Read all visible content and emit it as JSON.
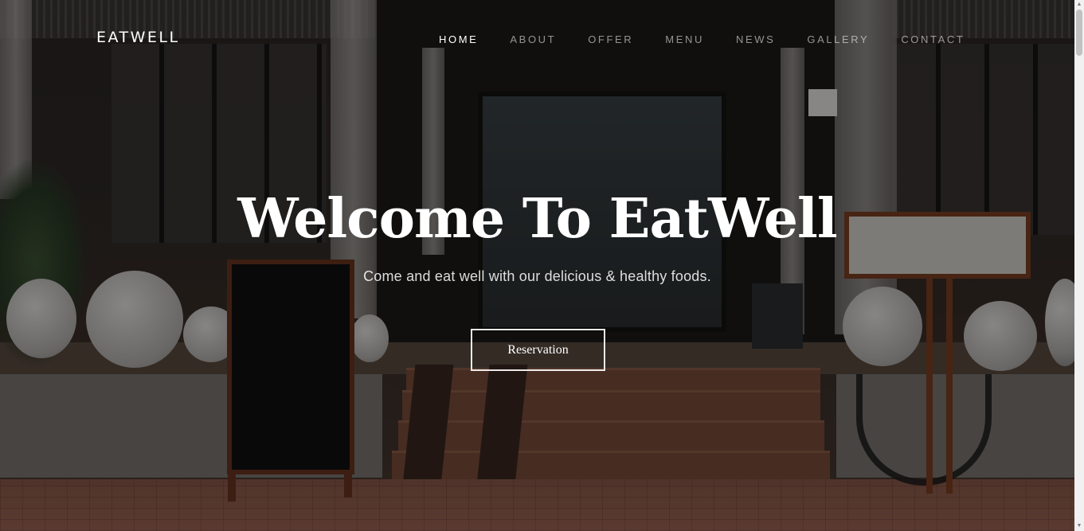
{
  "brand": {
    "name": "EATWELL"
  },
  "nav": {
    "items": [
      {
        "label": "HOME",
        "active": true
      },
      {
        "label": "ABOUT",
        "active": false
      },
      {
        "label": "OFFER",
        "active": false
      },
      {
        "label": "MENU",
        "active": false
      },
      {
        "label": "NEWS",
        "active": false
      },
      {
        "label": "GALLERY",
        "active": false
      },
      {
        "label": "CONTACT",
        "active": false
      }
    ]
  },
  "hero": {
    "title": "Welcome To EatWell",
    "subtitle": "Come and eat well with our delicious & healthy foods.",
    "button_label": "Reservation",
    "background_image": "restaurant-storefront-photo",
    "overlay_color": "#000000"
  },
  "colors": {
    "text_primary": "#ffffff",
    "nav_inactive": "#ffffff8c"
  },
  "scrollbar": {
    "up_icon": "scroll-up-arrow-icon",
    "down_icon": "scroll-down-arrow-icon"
  }
}
